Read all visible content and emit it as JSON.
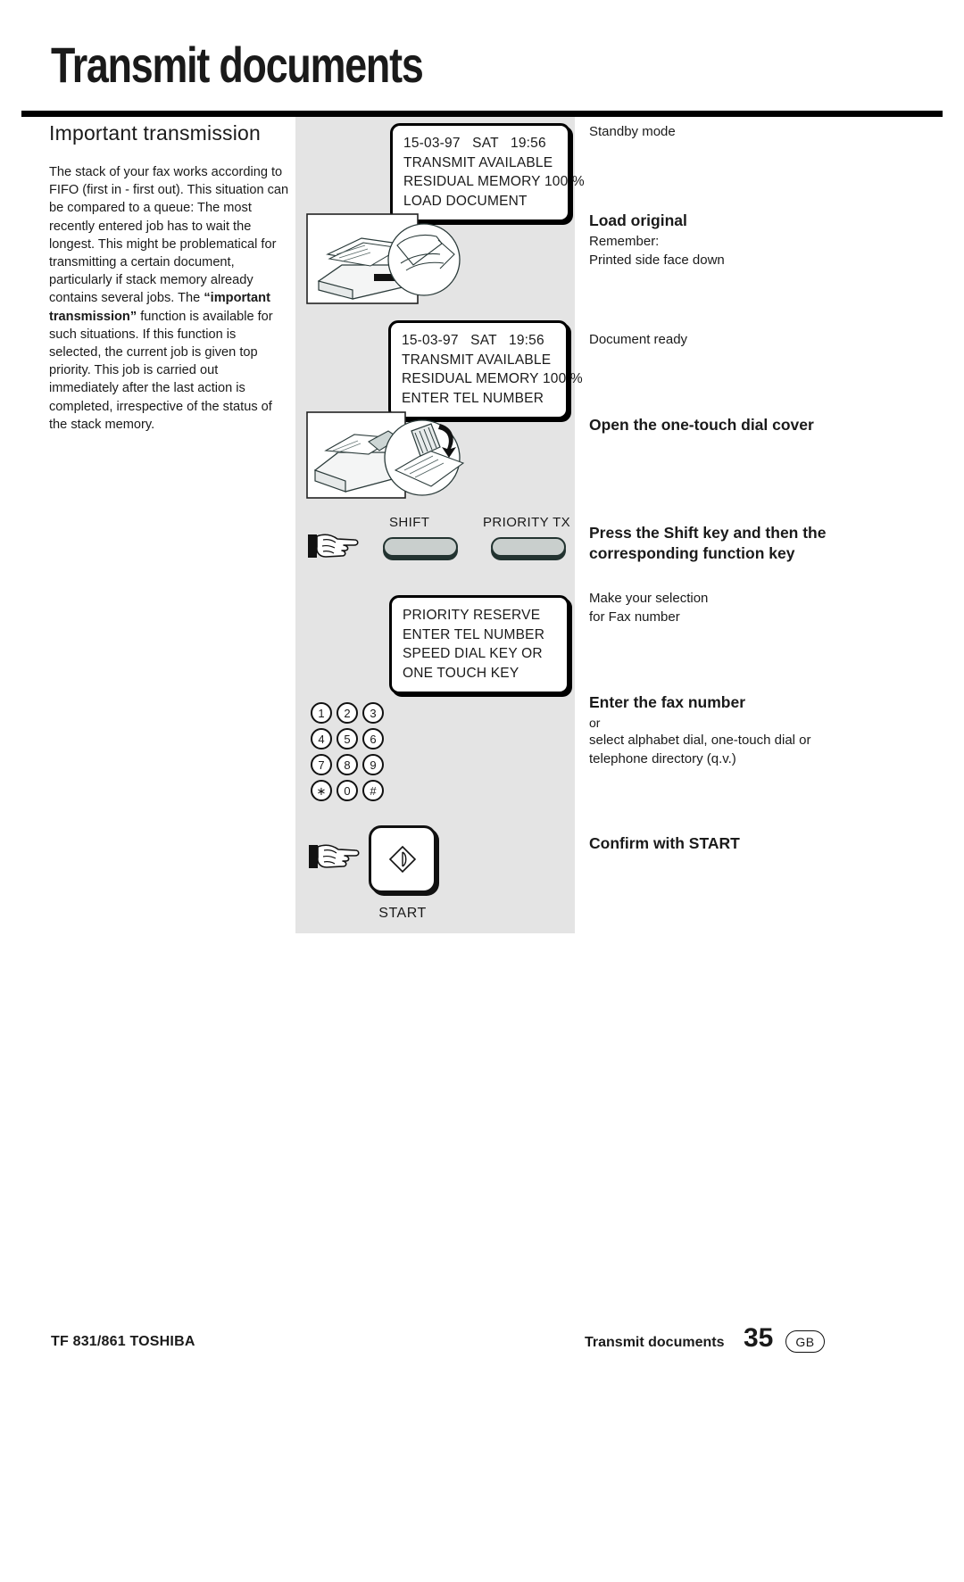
{
  "page": {
    "title": "Transmit documents"
  },
  "left_column": {
    "heading": "Important  transmission",
    "paragraph_part1": "The stack of your fax works according to FIFO (first in - first out). This situation can be compared to a queue: The most recently entered job has to wait the longest. This might be problematical for transmitting a certain document, particularly if stack memory already contains several jobs. The ",
    "bold_phrase": "“important transmission”",
    "paragraph_part2": " function is available for such situations. If this function is selected, the current job is given top priority. This job is carried out immediately after the last action is completed, irrespective of the status of the stack memory."
  },
  "displays": [
    {
      "id": "lcd1",
      "lines": [
        "15-03-97   SAT   19:56",
        "TRANSMIT AVAILABLE",
        "RESIDUAL MEMORY 100 %",
        "LOAD DOCUMENT"
      ]
    },
    {
      "id": "lcd2",
      "lines": [
        "15-03-97   SAT   19:56",
        "TRANSMIT AVAILABLE",
        "RESIDUAL MEMORY 100 %",
        "ENTER TEL NUMBER"
      ]
    },
    {
      "id": "lcd3",
      "lines": [
        "PRIORITY RESERVE",
        "ENTER TEL NUMBER",
        "SPEED DIAL KEY OR",
        "ONE TOUCH KEY"
      ]
    }
  ],
  "keys": {
    "shift_label": "SHIFT",
    "priority_label": "PRIORITY TX",
    "start_label": "START"
  },
  "keypad": {
    "rows": [
      [
        "1",
        "2",
        "3"
      ],
      [
        "4",
        "5",
        "6"
      ],
      [
        "7",
        "8",
        "9"
      ],
      [
        "∗",
        "0",
        "#"
      ]
    ]
  },
  "steps": [
    {
      "heading": "",
      "plain": "Standby mode"
    },
    {
      "heading": "Load original",
      "line1": "Remember:",
      "line2": "Printed side face down"
    },
    {
      "heading": "",
      "plain": "Document ready"
    },
    {
      "heading": "Open the one-touch dial cover"
    },
    {
      "heading": "Press the Shift key and then the corresponding function key"
    },
    {
      "heading": "",
      "line1": "Make your selection",
      "line2": "for Fax number"
    },
    {
      "heading": "Enter the fax number",
      "line1": "or",
      "line2": "select alphabet dial, one-touch dial or",
      "line3": "telephone directory (q.v.)"
    },
    {
      "heading": "Confirm with START"
    }
  ],
  "footer": {
    "left": "TF 831/861 TOSHIBA",
    "middle": "Transmit documents",
    "page_number": "35",
    "region": "GB"
  },
  "colors": {
    "panel_bg": "#e4e4e4",
    "key_fill": "#c9cfcd",
    "key_edge": "#223330",
    "ink": "#1a1a1a"
  }
}
